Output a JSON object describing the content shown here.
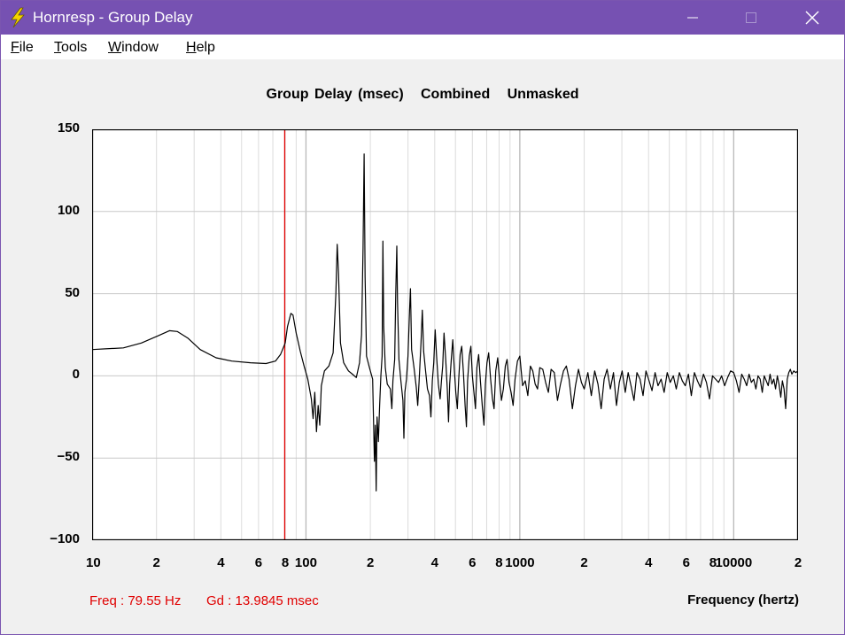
{
  "window": {
    "title": "Hornresp - Group Delay",
    "controls": {
      "minimize": "—",
      "maximize": "□",
      "close": "✕"
    }
  },
  "menu": [
    {
      "label": "File",
      "accel": "F"
    },
    {
      "label": "Tools",
      "accel": "T"
    },
    {
      "label": "Window",
      "accel": "W"
    },
    {
      "label": "Help",
      "accel": "H"
    }
  ],
  "graph": {
    "title_parts": [
      "Group Delay (msec)",
      "Combined",
      "Unmasked"
    ],
    "readout_freq": "Freq : 79.55 Hz",
    "readout_gd": "Gd : 13.9845 msec",
    "xlabel": "Frequency (hertz)"
  },
  "chart_data": {
    "type": "line",
    "x_scale": "log",
    "xlim": [
      10,
      20000
    ],
    "ylim": [
      -100,
      150
    ],
    "y_ticks": [
      "150",
      "100",
      "50",
      "0",
      "−50",
      "−100"
    ],
    "x_tick_labels": [
      {
        "f": 10,
        "t": "10"
      },
      {
        "f": 20,
        "t": "2"
      },
      {
        "f": 40,
        "t": "4"
      },
      {
        "f": 60,
        "t": "6"
      },
      {
        "f": 80,
        "t": "8"
      },
      {
        "f": 100,
        "t": "100"
      },
      {
        "f": 200,
        "t": "2"
      },
      {
        "f": 400,
        "t": "4"
      },
      {
        "f": 600,
        "t": "6"
      },
      {
        "f": 800,
        "t": "8"
      },
      {
        "f": 1000,
        "t": "1000"
      },
      {
        "f": 2000,
        "t": "2"
      },
      {
        "f": 4000,
        "t": "4"
      },
      {
        "f": 6000,
        "t": "6"
      },
      {
        "f": 8000,
        "t": "8"
      },
      {
        "f": 10000,
        "t": "10000"
      },
      {
        "f": 20000,
        "t": "2"
      }
    ],
    "marker_freq": 79.55,
    "series": [
      {
        "color": "#000000",
        "points": [
          [
            10,
            16
          ],
          [
            14,
            17
          ],
          [
            17,
            20
          ],
          [
            20,
            24
          ],
          [
            23,
            27.5
          ],
          [
            25,
            27
          ],
          [
            28,
            23
          ],
          [
            32,
            16
          ],
          [
            38,
            11
          ],
          [
            45,
            9
          ],
          [
            55,
            8
          ],
          [
            65,
            7.5
          ],
          [
            72,
            9
          ],
          [
            76,
            13
          ],
          [
            80,
            20
          ],
          [
            82,
            30
          ],
          [
            85,
            38
          ],
          [
            87,
            37
          ],
          [
            90,
            26
          ],
          [
            94,
            15
          ],
          [
            98,
            6
          ],
          [
            102,
            -2
          ],
          [
            106,
            -14
          ],
          [
            108,
            -26
          ],
          [
            110,
            -10
          ],
          [
            112,
            -34
          ],
          [
            114,
            -18
          ],
          [
            116,
            -30
          ],
          [
            118,
            -6
          ],
          [
            122,
            3
          ],
          [
            128,
            6
          ],
          [
            134,
            14
          ],
          [
            138,
            50
          ],
          [
            140,
            80
          ],
          [
            142,
            62
          ],
          [
            145,
            20
          ],
          [
            150,
            8
          ],
          [
            158,
            3
          ],
          [
            165,
            1
          ],
          [
            172,
            -1
          ],
          [
            178,
            8
          ],
          [
            182,
            25
          ],
          [
            185,
            78
          ],
          [
            187,
            135
          ],
          [
            189,
            60
          ],
          [
            192,
            12
          ],
          [
            198,
            5
          ],
          [
            205,
            -2
          ],
          [
            209,
            -52
          ],
          [
            211,
            -30
          ],
          [
            213,
            -70
          ],
          [
            215,
            -25
          ],
          [
            218,
            -40
          ],
          [
            221,
            -18
          ],
          [
            224,
            0
          ],
          [
            227,
            12
          ],
          [
            229,
            82
          ],
          [
            231,
            30
          ],
          [
            235,
            5
          ],
          [
            240,
            -5
          ],
          [
            248,
            -8
          ],
          [
            252,
            -20
          ],
          [
            255,
            -3
          ],
          [
            260,
            10
          ],
          [
            263,
            50
          ],
          [
            266,
            79
          ],
          [
            268,
            45
          ],
          [
            272,
            10
          ],
          [
            278,
            -3
          ],
          [
            284,
            -15
          ],
          [
            287,
            -38
          ],
          [
            290,
            -10
          ],
          [
            295,
            -2
          ],
          [
            300,
            12
          ],
          [
            305,
            40
          ],
          [
            308,
            53
          ],
          [
            312,
            16
          ],
          [
            320,
            5
          ],
          [
            328,
            -7
          ],
          [
            333,
            -18
          ],
          [
            338,
            -4
          ],
          [
            345,
            20
          ],
          [
            350,
            40
          ],
          [
            355,
            15
          ],
          [
            362,
            4
          ],
          [
            370,
            -8
          ],
          [
            378,
            -12
          ],
          [
            384,
            -25
          ],
          [
            390,
            -3
          ],
          [
            396,
            8
          ],
          [
            402,
            28
          ],
          [
            408,
            12
          ],
          [
            416,
            -5
          ],
          [
            424,
            -14
          ],
          [
            430,
            -3
          ],
          [
            436,
            6
          ],
          [
            442,
            26
          ],
          [
            450,
            10
          ],
          [
            458,
            -8
          ],
          [
            464,
            -28
          ],
          [
            470,
            -5
          ],
          [
            478,
            10
          ],
          [
            486,
            22
          ],
          [
            494,
            4
          ],
          [
            502,
            -10
          ],
          [
            510,
            -20
          ],
          [
            518,
            -2
          ],
          [
            526,
            13
          ],
          [
            535,
            18
          ],
          [
            545,
            2
          ],
          [
            555,
            -18
          ],
          [
            563,
            -31
          ],
          [
            570,
            -3
          ],
          [
            580,
            12
          ],
          [
            590,
            18
          ],
          [
            600,
            0
          ],
          [
            612,
            -12
          ],
          [
            620,
            -20
          ],
          [
            630,
            5
          ],
          [
            642,
            13
          ],
          [
            655,
            -4
          ],
          [
            668,
            -19
          ],
          [
            680,
            -30
          ],
          [
            690,
            -5
          ],
          [
            702,
            8
          ],
          [
            715,
            14
          ],
          [
            730,
            -2
          ],
          [
            745,
            -14
          ],
          [
            758,
            -20
          ],
          [
            772,
            3
          ],
          [
            788,
            11
          ],
          [
            805,
            -3
          ],
          [
            820,
            -15
          ],
          [
            838,
            -8
          ],
          [
            855,
            6
          ],
          [
            872,
            10
          ],
          [
            890,
            -4
          ],
          [
            910,
            -10
          ],
          [
            930,
            -18
          ],
          [
            950,
            -2
          ],
          [
            975,
            9
          ],
          [
            1000,
            12
          ],
          [
            1030,
            -6
          ],
          [
            1060,
            -3
          ],
          [
            1090,
            -12
          ],
          [
            1120,
            6
          ],
          [
            1150,
            3
          ],
          [
            1180,
            -5
          ],
          [
            1210,
            -8
          ],
          [
            1240,
            5
          ],
          [
            1280,
            4
          ],
          [
            1320,
            -4
          ],
          [
            1360,
            -10
          ],
          [
            1400,
            4
          ],
          [
            1450,
            2
          ],
          [
            1500,
            -15
          ],
          [
            1550,
            -5
          ],
          [
            1600,
            3
          ],
          [
            1650,
            6
          ],
          [
            1700,
            -2
          ],
          [
            1760,
            -20
          ],
          [
            1820,
            -6
          ],
          [
            1880,
            4
          ],
          [
            1940,
            -4
          ],
          [
            2000,
            -8
          ],
          [
            2080,
            2
          ],
          [
            2160,
            -12
          ],
          [
            2240,
            3
          ],
          [
            2320,
            -5
          ],
          [
            2400,
            -20
          ],
          [
            2480,
            -2
          ],
          [
            2560,
            4
          ],
          [
            2650,
            -8
          ],
          [
            2740,
            2
          ],
          [
            2830,
            -18
          ],
          [
            2920,
            -4
          ],
          [
            3010,
            3
          ],
          [
            3110,
            -10
          ],
          [
            3210,
            2
          ],
          [
            3310,
            -6
          ],
          [
            3420,
            -15
          ],
          [
            3530,
            2
          ],
          [
            3650,
            -2
          ],
          [
            3770,
            -12
          ],
          [
            3890,
            3
          ],
          [
            4020,
            -3
          ],
          [
            4150,
            -9
          ],
          [
            4290,
            2
          ],
          [
            4430,
            -6
          ],
          [
            4580,
            -2
          ],
          [
            4730,
            -10
          ],
          [
            4890,
            2
          ],
          [
            5050,
            -4
          ],
          [
            5220,
            0
          ],
          [
            5390,
            -8
          ],
          [
            5570,
            2
          ],
          [
            5750,
            -3
          ],
          [
            5940,
            -6
          ],
          [
            6140,
            1
          ],
          [
            6340,
            -12
          ],
          [
            6550,
            2
          ],
          [
            6770,
            -3
          ],
          [
            6990,
            -7
          ],
          [
            7220,
            1
          ],
          [
            7460,
            -4
          ],
          [
            7710,
            -14
          ],
          [
            7960,
            0
          ],
          [
            8230,
            -2
          ],
          [
            8500,
            -4
          ],
          [
            8780,
            0
          ],
          [
            9070,
            -6
          ],
          [
            9370,
            -1
          ],
          [
            9680,
            3
          ],
          [
            10000,
            2
          ],
          [
            10300,
            -3
          ],
          [
            10600,
            -10
          ],
          [
            10900,
            1
          ],
          [
            11200,
            -2
          ],
          [
            11500,
            -6
          ],
          [
            11800,
            1
          ],
          [
            12100,
            -4
          ],
          [
            12400,
            -2
          ],
          [
            12700,
            -8
          ],
          [
            13000,
            0
          ],
          [
            13300,
            -2
          ],
          [
            13600,
            -10
          ],
          [
            13900,
            0
          ],
          [
            14200,
            -3
          ],
          [
            14500,
            -6
          ],
          [
            14800,
            1
          ],
          [
            15100,
            -5
          ],
          [
            15400,
            -2
          ],
          [
            15700,
            -8
          ],
          [
            16000,
            0
          ],
          [
            16300,
            -5
          ],
          [
            16600,
            -13
          ],
          [
            16900,
            -3
          ],
          [
            17200,
            -8
          ],
          [
            17500,
            -20
          ],
          [
            17800,
            -2
          ],
          [
            18100,
            2
          ],
          [
            18400,
            4
          ],
          [
            18700,
            1
          ],
          [
            19100,
            3
          ],
          [
            19500,
            2
          ],
          [
            20000,
            3
          ]
        ]
      }
    ]
  },
  "colors": {
    "titlebar": "#7651b2",
    "marker": "#e00000",
    "grid": "#c8c8c8",
    "trace": "#000000"
  }
}
